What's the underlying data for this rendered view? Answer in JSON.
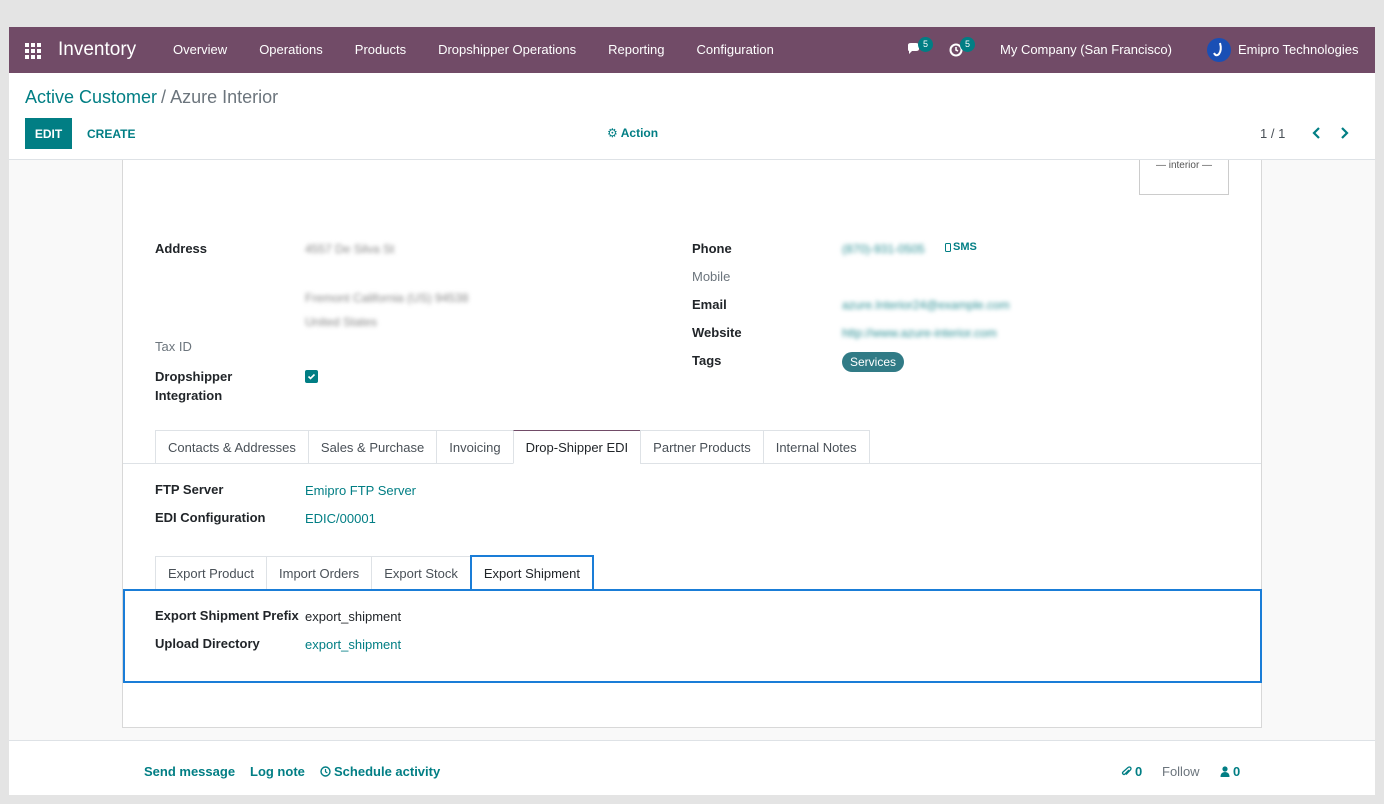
{
  "navbar": {
    "app_name": "Inventory",
    "menu": [
      "Overview",
      "Operations",
      "Products",
      "Dropshipper Operations",
      "Reporting",
      "Configuration"
    ],
    "messages_count": "5",
    "activities_count": "5",
    "company": "My Company (San Francisco)",
    "user": "Emipro Technologies"
  },
  "control": {
    "breadcrumb_parent": "Active Customer",
    "breadcrumb_separator": "/",
    "breadcrumb_current": "Azure Interior",
    "edit_label": "EDIT",
    "create_label": "CREATE",
    "action_label": "Action",
    "pager": "1 / 1"
  },
  "record": {
    "logo_text": "— interior —",
    "address_label": "Address",
    "address_line1": "4557 De Silva St",
    "address_line2": "Fremont  California (US)  94538",
    "address_line3": "United States",
    "tax_id_label": "Tax ID",
    "dropshipper_label_1": "Dropshipper",
    "dropshipper_label_2": "Integration",
    "dropshipper_checked": true,
    "phone_label": "Phone",
    "phone_value": "(870)-931-0505",
    "sms_label": "SMS",
    "mobile_label": "Mobile",
    "email_label": "Email",
    "email_value": "azure.Interior24@example.com",
    "website_label": "Website",
    "website_value": "http://www.azure-interior.com",
    "tags_label": "Tags",
    "tag_value": "Services"
  },
  "tabs": [
    "Contacts & Addresses",
    "Sales & Purchase",
    "Invoicing",
    "Drop-Shipper EDI",
    "Partner Products",
    "Internal Notes"
  ],
  "active_tab": "Drop-Shipper EDI",
  "edi": {
    "ftp_label": "FTP Server",
    "ftp_value": "Emipro FTP Server",
    "edi_config_label": "EDI Configuration",
    "edi_config_value": "EDIC/00001"
  },
  "subtabs": [
    "Export Product",
    "Import Orders",
    "Export Stock",
    "Export Shipment"
  ],
  "active_subtab": "Export Shipment",
  "export_shipment": {
    "prefix_label": "Export Shipment Prefix",
    "prefix_value": "export_shipment",
    "upload_label": "Upload Directory",
    "upload_value": "export_shipment"
  },
  "chatter": {
    "send_message": "Send message",
    "log_note": "Log note",
    "schedule_activity": "Schedule activity",
    "attachments_count": "0",
    "follow": "Follow",
    "followers_count": "0"
  },
  "colors": {
    "navbar": "#714b67",
    "accent": "#017e84",
    "highlight": "#1a7dd7"
  }
}
